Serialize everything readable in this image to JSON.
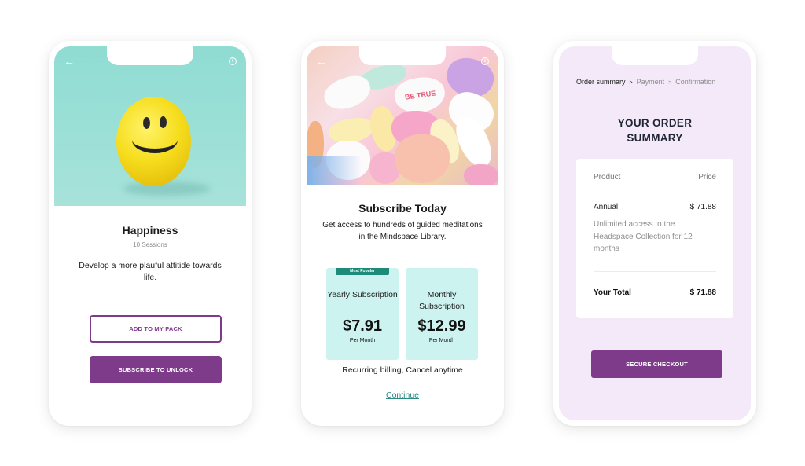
{
  "colors": {
    "brand_purple": "#7d3b8a",
    "teal_card": "#cdf3f0",
    "badge_green": "#1e8a78",
    "link_teal": "#2a8a7d",
    "order_bg": "#f3e9f8"
  },
  "icons": {
    "back": "←",
    "info": "i"
  },
  "pack_screen": {
    "title": "Happiness",
    "sessions": "10 Sessions",
    "description": "Develop a more plauful attitide towards life.",
    "add_button": "ADD TO MY PACK",
    "subscribe_button": "SUBSCRIBE TO UNLOCK"
  },
  "subscribe_screen": {
    "candy_text": "BE TRUE",
    "title": "Subscribe Today",
    "description": "Get access to hundreds of guided meditations in the Mindspace Library.",
    "plans": [
      {
        "badge": "Most Popular",
        "name": "Yearly Subscription",
        "price": "$7.91",
        "period": "Per Month"
      },
      {
        "badge": "",
        "name": "Monthly Subscription",
        "price": "$12.99",
        "period": "Per Month"
      }
    ],
    "billing_note": "Recurring billing, Cancel anytime",
    "continue_link": "Continue"
  },
  "order_screen": {
    "breadcrumb": {
      "steps": [
        "Order summary",
        "Payment",
        "Confirmation"
      ],
      "separator": ">"
    },
    "title": "YOUR ORDER SUMMARY",
    "table": {
      "product_header": "Product",
      "price_header": "Price",
      "item_name": "Annual",
      "item_price": "$ 71.88",
      "item_note": "Unlimited access to the Headspace Collection for 12 months",
      "total_label": "Your Total",
      "total_value": "$ 71.88"
    },
    "checkout_button": "SECURE CHECKOUT"
  }
}
